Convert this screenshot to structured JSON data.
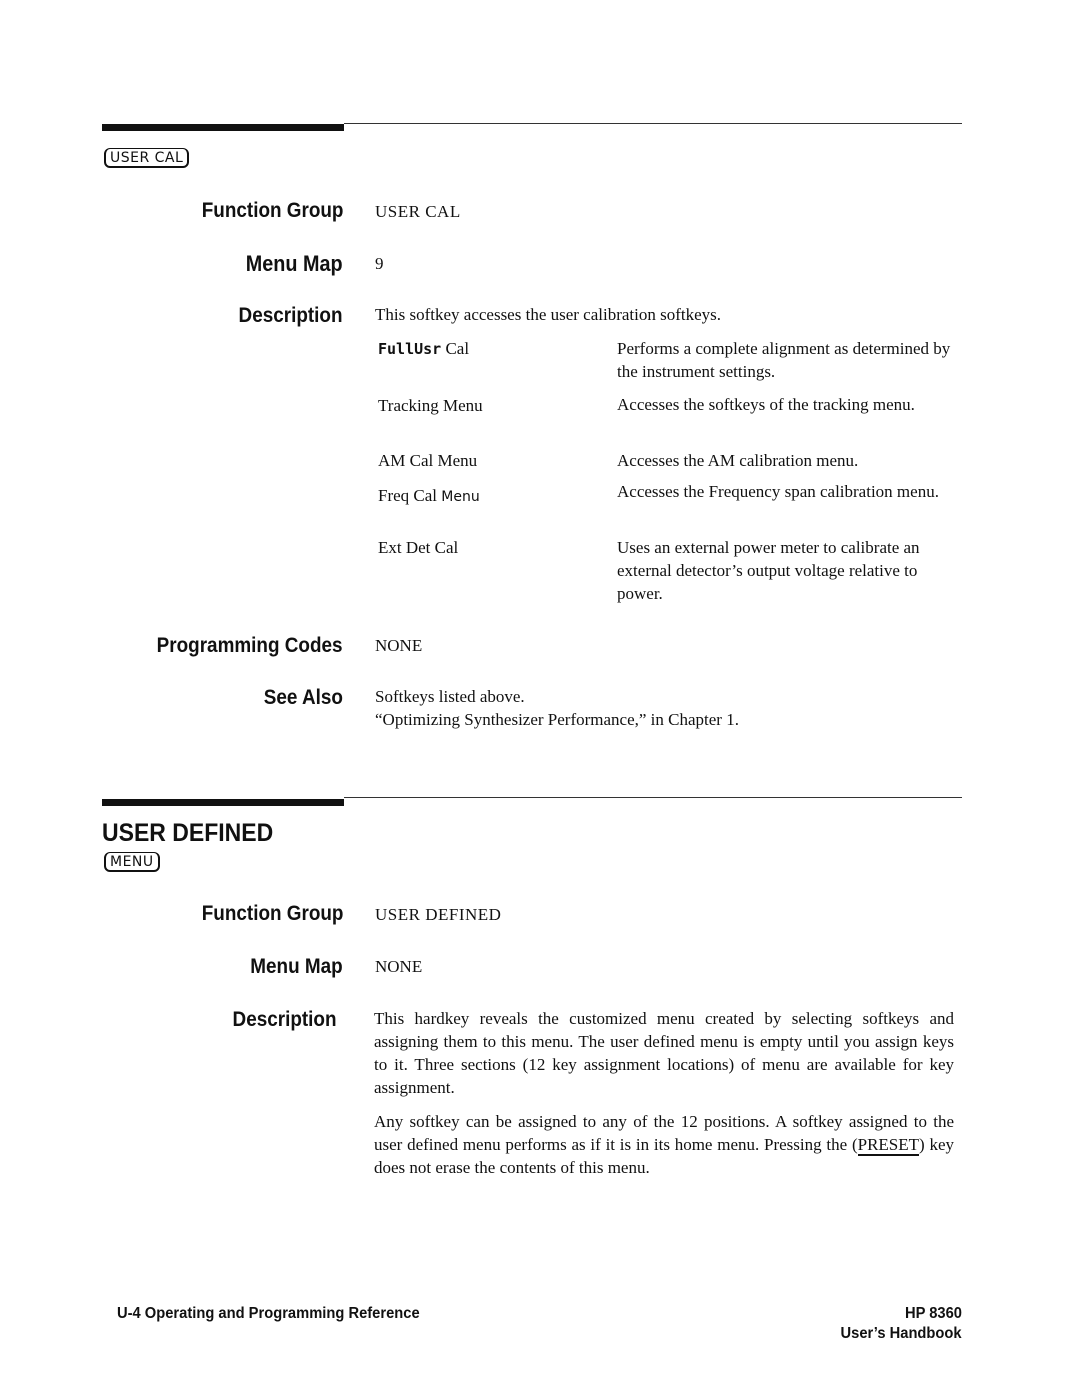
{
  "section1": {
    "key_label": "USER CAL",
    "function_group": {
      "label": "Function Group",
      "value": "USER CAL"
    },
    "menu_map": {
      "label": "Menu Map",
      "value": "9"
    },
    "description": {
      "label": "Description",
      "intro": "This softkey accesses the user calibration softkeys.",
      "softkeys": [
        {
          "name_mono": "FullUsr",
          "name_rest": " Cal",
          "desc": "Performs a complete alignment as determined by the instrument settings."
        },
        {
          "name": "Tracking Menu",
          "desc": "Accesses the softkeys of the tracking menu."
        },
        {
          "name": "AM Cal Menu",
          "desc": "Accesses the AM calibration menu."
        },
        {
          "name_main": "Freq Cal ",
          "name_small": "Menu",
          "desc": "Accesses the Frequency span calibration menu."
        },
        {
          "name": "Ext Det Cal",
          "desc": "Uses an external power meter to calibrate an external detector’s output voltage relative to power."
        }
      ]
    },
    "programming_codes": {
      "label": "Programming Codes",
      "value": "NONE"
    },
    "see_also": {
      "label": "See Also",
      "lines": [
        "Softkeys listed above.",
        "“Optimizing Synthesizer Performance,” in Chapter 1."
      ]
    }
  },
  "section2": {
    "title": "USER DEFINED",
    "key_label": "MENU",
    "function_group": {
      "label": "Function Group",
      "value": "USER DEFINED"
    },
    "menu_map": {
      "label": "Menu Map",
      "value": "NONE"
    },
    "description": {
      "label": "Description",
      "para1": "This hardkey reveals the customized menu created by selecting softkeys and assigning them to this menu. The user defined menu is empty until you assign keys to it. Three sections (12 key assignment locations) of menu are available for key assignment.",
      "para2_before": "Any softkey can be assigned to any of the 12 positions. A softkey assigned to the user defined menu performs as if it is in its home menu. Pressing the (",
      "para2_key": "PRESET",
      "para2_after": ") key does not erase the contents of this menu."
    }
  },
  "footer": {
    "left": "U-4 Operating and Programming Reference",
    "right_line1": "HP 8360",
    "right_line2": "User’s Handbook"
  }
}
